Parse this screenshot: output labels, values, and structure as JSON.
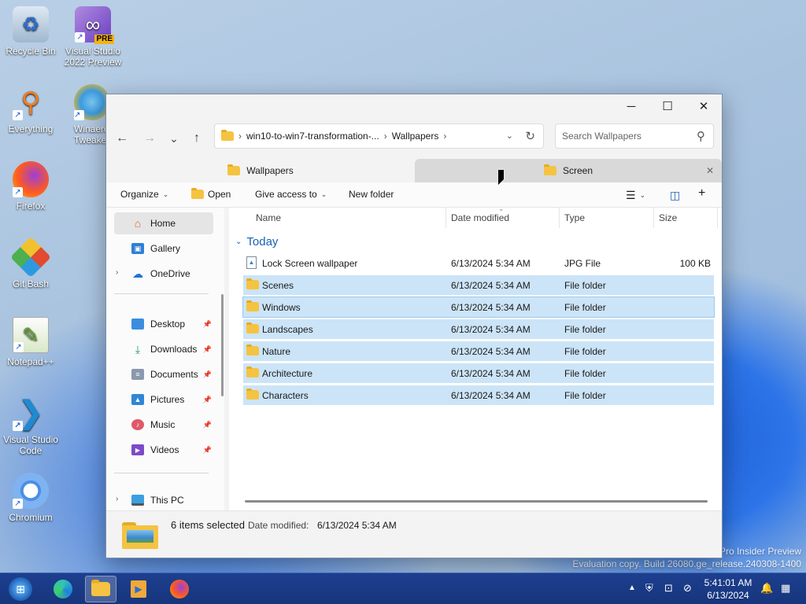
{
  "desktop": {
    "icons": [
      {
        "label": "Recycle Bin",
        "icon": "recycle-bin-icon",
        "color": "#3a87d6"
      },
      {
        "label": "Visual Studio 2022 Preview",
        "icon": "visual-studio-icon",
        "color": "#8a5cd0",
        "badge": "PRE"
      },
      {
        "label": "Everything",
        "icon": "everything-search-icon",
        "color": "#f07c1e"
      },
      {
        "label": "Winaero Tweaker",
        "icon": "winaero-tweaker-icon",
        "color": "#e7b63a"
      },
      {
        "label": "Firefox",
        "icon": "firefox-icon",
        "color": "#ff6a1a"
      },
      {
        "label": "Git Bash",
        "icon": "git-bash-icon",
        "color": "#e24b2f"
      },
      {
        "label": "Notepad++",
        "icon": "notepadpp-icon",
        "color": "#8bc34a"
      },
      {
        "label": "Visual Studio Code",
        "icon": "vscode-icon",
        "color": "#1f8ad2"
      },
      {
        "label": "Chromium",
        "icon": "chromium-icon",
        "color": "#4a8fe7"
      }
    ],
    "watermark_line1": "Pro Insider Preview",
    "watermark_line2": "Evaluation copy. Build 26080.ge_release.240308-1400"
  },
  "explorer": {
    "window_controls": {
      "minimize": "─",
      "maximize": "☐",
      "close": "✕"
    },
    "nav": {
      "back": "←",
      "forward": "→",
      "recent": "⌄",
      "up": "↑"
    },
    "address": {
      "segment1": "win10-to-win7-transformation-...",
      "segment2": "Wallpapers",
      "sep": "›"
    },
    "search": {
      "placeholder": "Search Wallpapers"
    },
    "tabs": [
      {
        "label": "Wallpapers",
        "active": true
      },
      {
        "label": "Screen",
        "active": false
      }
    ],
    "toolbar": {
      "organize": "Organize",
      "open": "Open",
      "give_access": "Give access to",
      "new_folder": "New folder"
    },
    "sidebar": {
      "home": "Home",
      "gallery": "Gallery",
      "onedrive": "OneDrive",
      "desktop": "Desktop",
      "downloads": "Downloads",
      "documents": "Documents",
      "pictures": "Pictures",
      "music": "Music",
      "videos": "Videos",
      "thispc": "This PC"
    },
    "columns": {
      "name": "Name",
      "date": "Date modified",
      "type": "Type",
      "size": "Size"
    },
    "group_label": "Today",
    "files": [
      {
        "name": "Lock Screen wallpaper",
        "date": "6/13/2024 5:34 AM",
        "type": "JPG File",
        "size": "100 KB",
        "selected": false
      },
      {
        "name": "Scenes",
        "date": "6/13/2024 5:34 AM",
        "type": "File folder",
        "size": "",
        "selected": true
      },
      {
        "name": "Windows",
        "date": "6/13/2024 5:34 AM",
        "type": "File folder",
        "size": "",
        "selected": true
      },
      {
        "name": "Landscapes",
        "date": "6/13/2024 5:34 AM",
        "type": "File folder",
        "size": "",
        "selected": true
      },
      {
        "name": "Nature",
        "date": "6/13/2024 5:34 AM",
        "type": "File folder",
        "size": "",
        "selected": true
      },
      {
        "name": "Architecture",
        "date": "6/13/2024 5:34 AM",
        "type": "File folder",
        "size": "",
        "selected": true
      },
      {
        "name": "Characters",
        "date": "6/13/2024 5:34 AM",
        "type": "File folder",
        "size": "",
        "selected": true
      }
    ],
    "status": {
      "selected": "6 items selected",
      "date_label": "Date modified:",
      "date_value": "6/13/2024 5:34 AM"
    }
  },
  "taskbar": {
    "time": "5:41:01 AM",
    "date": "6/13/2024",
    "accent": "#1d3f8f"
  }
}
